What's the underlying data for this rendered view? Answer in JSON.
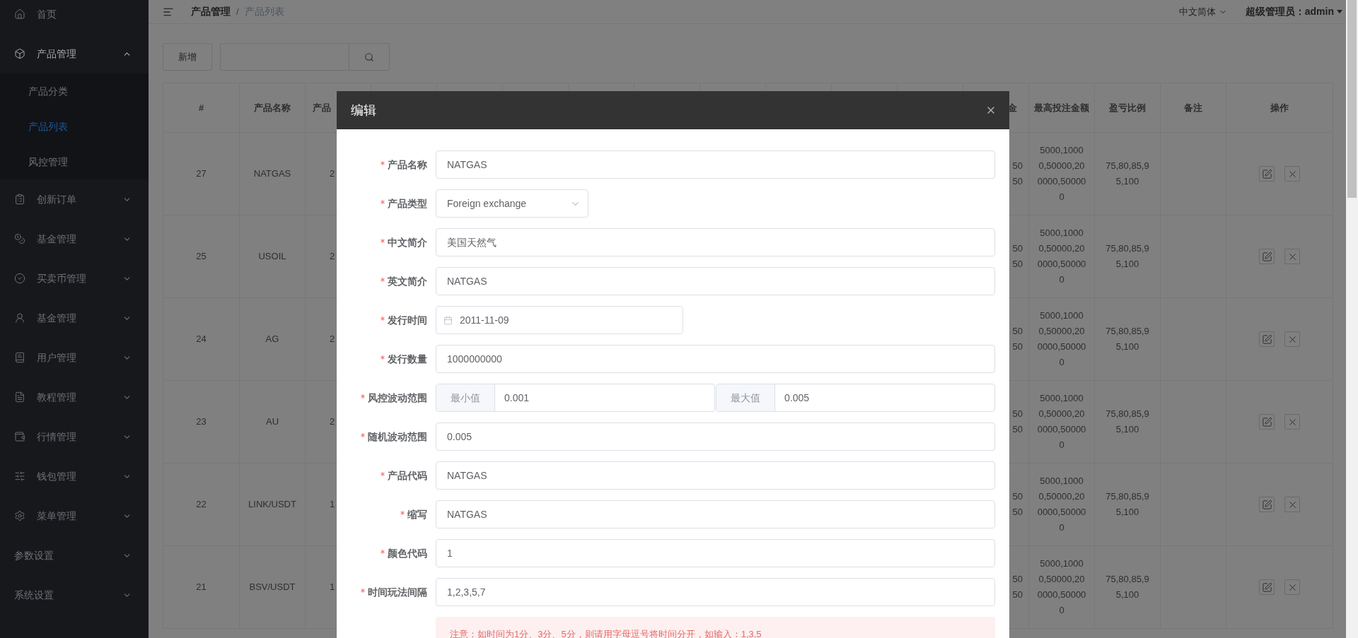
{
  "sidebar": {
    "items": [
      {
        "label": "首页",
        "expanded": false,
        "has_children": false
      },
      {
        "label": "产品管理",
        "expanded": true,
        "has_children": true,
        "children": [
          {
            "label": "产品分类",
            "selected": false
          },
          {
            "label": "产品列表",
            "selected": true
          },
          {
            "label": "风控管理",
            "selected": false
          }
        ]
      },
      {
        "label": "创新订单",
        "expanded": false,
        "has_children": true
      },
      {
        "label": "基金管理",
        "expanded": false,
        "has_children": true
      },
      {
        "label": "买卖币管理",
        "expanded": false,
        "has_children": true
      },
      {
        "label": "基金管理",
        "expanded": false,
        "has_children": true
      },
      {
        "label": "用户管理",
        "expanded": false,
        "has_children": true
      },
      {
        "label": "教程管理",
        "expanded": false,
        "has_children": true
      },
      {
        "label": "行情管理",
        "expanded": false,
        "has_children": true
      },
      {
        "label": "钱包管理",
        "expanded": false,
        "has_children": true
      },
      {
        "label": "菜单管理",
        "expanded": false,
        "has_children": true
      },
      {
        "label": "参数设置",
        "expanded": false,
        "has_children": true
      },
      {
        "label": "系统设置",
        "expanded": false,
        "has_children": true
      }
    ]
  },
  "header": {
    "breadcrumb": [
      "产品管理",
      "产品列表"
    ],
    "separator": "/",
    "language": "中文简体",
    "user": "超级管理员：admin"
  },
  "toolbar": {
    "add_button": "新增"
  },
  "table": {
    "columns": [
      "#",
      "产品名称",
      "产品",
      "金",
      "最高投注金额",
      "盈亏比例",
      "备注",
      "操作"
    ],
    "rows": [
      {
        "id": "27",
        "name": "NATGAS",
        "column_3": "2",
        "column_13": [
          "50",
          "50"
        ],
        "max_bet": "5000,10000,50000,200000,500000",
        "ratio": "75,80,85,95,100"
      },
      {
        "id": "25",
        "name": "USOIL",
        "column_3": "2",
        "column_13": [
          "50",
          "50"
        ],
        "max_bet": "5000,10000,50000,200000,500000",
        "ratio": "75,80,85,95,100"
      },
      {
        "id": "24",
        "name": "AG",
        "column_3": "2",
        "column_13": [
          "50",
          "50"
        ],
        "max_bet": "5000,10000,50000,200000,500000",
        "ratio": "75,80,85,95,100"
      },
      {
        "id": "23",
        "name": "AU",
        "column_3": "2",
        "column_13": [
          "50",
          "50"
        ],
        "max_bet": "5000,10000,50000,200000,500000",
        "ratio": "75,80,85,95,100"
      },
      {
        "id": "22",
        "name": "LINK/USDT",
        "column_3": "1",
        "column_13": [
          "50",
          "50"
        ],
        "max_bet": "5000,10000,50000,200000,500000",
        "ratio": "75,80,85,95,100"
      },
      {
        "id": "21",
        "name": "BSV/USDT",
        "column_3": "1",
        "column_13": [
          "50",
          "50"
        ],
        "max_bet": "5000,10000,50000,200000,500000",
        "ratio": "75,80,85,95,100"
      }
    ]
  },
  "dialog": {
    "title": "编辑",
    "fields": [
      {
        "kind": "text",
        "label": "产品名称",
        "required": true,
        "value": "NATGAS"
      },
      {
        "kind": "select",
        "label": "产品类型",
        "required": true,
        "value": "Foreign exchange"
      },
      {
        "kind": "text",
        "label": "中文简介",
        "required": true,
        "value": "美国天然气"
      },
      {
        "kind": "text",
        "label": "英文简介",
        "required": true,
        "value": "NATGAS"
      },
      {
        "kind": "date",
        "label": "发行时间",
        "required": true,
        "value": "2011-11-09"
      },
      {
        "kind": "text",
        "label": "发行数量",
        "required": true,
        "value": "1000000000"
      },
      {
        "kind": "range",
        "label": "风控波动范围",
        "required": true,
        "min_label": "最小值",
        "min_value": "0.001",
        "max_label": "最大值",
        "max_value": "0.005"
      },
      {
        "kind": "text",
        "label": "随机波动范围",
        "required": true,
        "value": "0.005"
      },
      {
        "kind": "text",
        "label": "产品代码",
        "required": true,
        "value": "NATGAS"
      },
      {
        "kind": "text",
        "label": "缩写",
        "required": true,
        "value": "NATGAS"
      },
      {
        "kind": "text",
        "label": "颜色代码",
        "required": true,
        "value": "1"
      },
      {
        "kind": "text",
        "label": "时间玩法间隔",
        "required": true,
        "value": "1,2,3,5,7"
      },
      {
        "kind": "note",
        "text": "注意：如时间为1分、3分、5分，则请用字母逗号将时间分开，如输入：1,3,5"
      }
    ]
  }
}
